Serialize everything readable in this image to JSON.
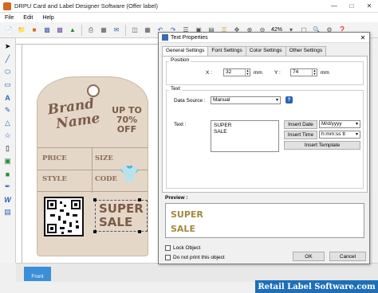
{
  "window": {
    "title": "DRPU Card and Label Designer Software (Offer label)"
  },
  "menu": [
    "File",
    "Edit",
    "Help"
  ],
  "toolbar": {
    "zoom": "42%"
  },
  "canvas": {
    "brand_line1": "Brand",
    "brand_line2": "Name",
    "upto_line1": "UP TO",
    "upto_line2": "70%",
    "upto_line3": "OFF",
    "price": "PRICE",
    "size": "SIZE",
    "style": "STYLE",
    "code": "CODE",
    "super_line1": "SUPER",
    "super_line2": "SALE"
  },
  "pages": {
    "front": "Front"
  },
  "footer": {
    "banner": "Retail Label Software.com"
  },
  "dialog": {
    "title": "Text Properties",
    "tabs": [
      "General Settings",
      "Font Settings",
      "Color Settings",
      "Other Settings"
    ],
    "position": {
      "label": "Position",
      "x_label": "X :",
      "x_value": "32",
      "x_unit": "mm",
      "y_label": "Y :",
      "y_value": "74",
      "y_unit": "mm"
    },
    "text": {
      "label": "Text",
      "data_source_label": "Data Source :",
      "data_source_value": "Manual",
      "text_label": "Text :",
      "text_line1": "SUPER",
      "text_line2": "SALE",
      "insert_date": "Insert Date",
      "date_format": "M/d/yyyy",
      "insert_time": "Insert Time",
      "time_format": "h:mm:ss tt",
      "insert_template": "Insert Template"
    },
    "preview": {
      "label": "Preview :",
      "line1": "SUPER",
      "line2": "SALE"
    },
    "lock_object": "Lock Object",
    "do_not_print": "Do not print this object",
    "ok": "OK",
    "cancel": "Cancel"
  }
}
